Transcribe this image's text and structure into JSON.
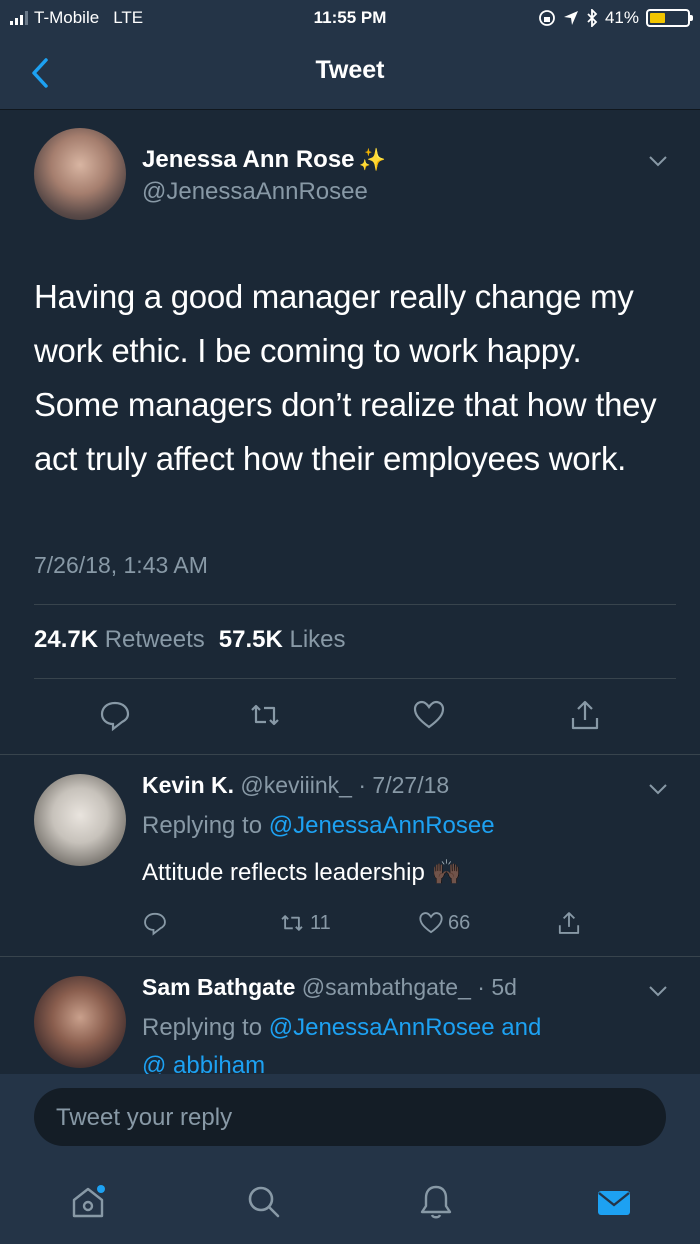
{
  "status": {
    "carrier": "T-Mobile",
    "network": "LTE",
    "time": "11:55 PM",
    "battery": "41%",
    "battery_level": 0.41
  },
  "nav": {
    "title": "Tweet"
  },
  "tweet": {
    "name": "Jenessa Ann Rose",
    "handle": "@JenessaAnnRosee",
    "text": "Having a good manager really change my work ethic. I be coming to work happy. Some managers don’t realize that how they act truly affect how their employees work.",
    "date": "7/26/18, 1:43 AM",
    "retweets_count": "24.7K",
    "retweets_label": "Retweets",
    "likes_count": "57.5K",
    "likes_label": "Likes"
  },
  "replies": [
    {
      "name": "Kevin K.",
      "handle": "@keviiink_",
      "time": "· 7/27/18",
      "replying_prefix": "Replying to",
      "replying_to": "@JenessaAnnRosee",
      "text": "Attitude reflects leadership",
      "emoji": "🙌🏿",
      "retweets": "11",
      "likes": "66"
    },
    {
      "name": "Sam Bathgate",
      "handle": "@sambathgate_",
      "time": "· 5d",
      "replying_prefix": "Replying to",
      "replying_to": "@JenessaAnnRosee and",
      "replying_to_2": "@ abbiham"
    }
  ],
  "compose": {
    "placeholder": "Tweet your reply"
  },
  "colors": {
    "background": "#1b2836",
    "bar": "#243447",
    "link": "#1da1f2",
    "muted": "#8899a6",
    "battery": "#f2c500"
  }
}
